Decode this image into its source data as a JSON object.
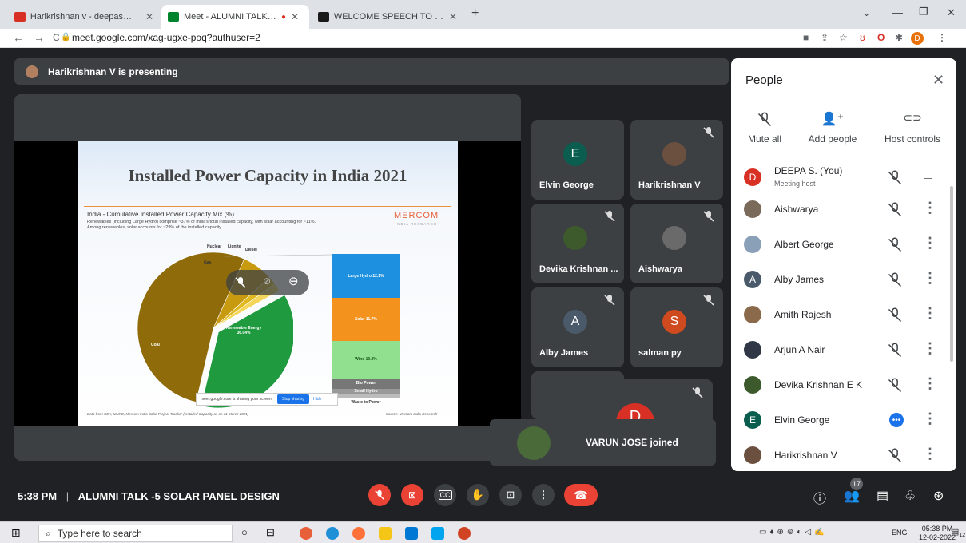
{
  "browser": {
    "tabs": [
      {
        "label": "Harikrishnan v - deepas@scmsgr",
        "favicon_color": "#d93025"
      },
      {
        "label": "Meet - ALUMNI TALK -5 SOL",
        "favicon_color": "#00832d"
      },
      {
        "label": "WELCOME SPEECH TO MEET ALU",
        "favicon_color": "#1a1a1a"
      }
    ],
    "new_tab": "+",
    "url": "meet.google.com/xag-ugxe-poq?authuser=2",
    "profile_initial": "D"
  },
  "meet": {
    "presenting_text": "Harikrishnan V is presenting",
    "slide": {
      "title": "Installed Power Capacity in India 2021",
      "chart_title": "India - Cumulative Installed Power Capacity Mix (%)",
      "chart_sub_1": "Renewables (including Large Hydro) comprise ~37% of India's total installed capacity, with solar accounting for ~11%.",
      "chart_sub_2": "Among renewables, solar accounts for ~29% of the installed capacity",
      "brand": "MERCOM",
      "brand_sub": "INDIA RESEARCH",
      "source_left": "Data from CEA, MNRE, Mercom India Solar Project Tracker (Installed Capacity as on 31 March 2021)",
      "source_right": "Source: Mercom India Research",
      "share_text": "meet.google.com is sharing your screen.",
      "stop_label": "Stop sharing",
      "hide_label": "Hide"
    },
    "tiles": [
      {
        "name": "Elvin George",
        "initial": "E",
        "color": "#0b5e4f"
      },
      {
        "name": "Harikrishnan V",
        "initial": "",
        "color": "#6b5040"
      },
      {
        "name": "Devika Krishnan ...",
        "initial": "",
        "color": "#3c5a2c"
      },
      {
        "name": "Aishwarya",
        "initial": "",
        "color": "#6a6a6a"
      },
      {
        "name": "Alby James",
        "initial": "A",
        "color": "#4a5a6a"
      },
      {
        "name": "salman py",
        "initial": "S",
        "color": "#d04a20"
      }
    ],
    "self_initial": "D",
    "toast": "VARUN JOSE joined",
    "clock": "5:38 PM",
    "divider": "|",
    "meeting_title": "ALUMNI TALK -5 SOLAR PANEL DESIGN",
    "participants_count": "17"
  },
  "chart_data": {
    "type": "pie",
    "title": "India - Cumulative Installed Power Capacity Mix (%)",
    "slices": [
      {
        "label": "Coal",
        "value": 52
      },
      {
        "label": "Renewable Energy",
        "value": 36.04
      },
      {
        "label": "Gas",
        "value": 6.5
      },
      {
        "label": "Nuclear",
        "value": 1.7
      },
      {
        "label": "Lignite",
        "value": 1.7
      },
      {
        "label": "Diesel",
        "value": 0.1
      }
    ],
    "breakdown": {
      "label": "Renewable Energy",
      "segments": [
        {
          "label": "Large Hydro 12.1%",
          "value": 12.1
        },
        {
          "label": "Solar 11.7%",
          "value": 11.7
        },
        {
          "label": "Wind 10.3%",
          "value": 10.3
        },
        {
          "label": "Bio Power",
          "value": 2.8
        },
        {
          "label": "Small Hydro",
          "value": 1.2
        },
        {
          "label": "Waste to Power",
          "value": 0.4
        }
      ]
    }
  },
  "people": {
    "title": "People",
    "actions": [
      "Mute all",
      "Add people",
      "Host controls"
    ],
    "list": [
      {
        "name": "DEEPA S. (You)",
        "sub": "Meeting host",
        "initial": "D",
        "color": "#d93025"
      },
      {
        "name": "Aishwarya",
        "initial": "",
        "color": "#7a6a5a"
      },
      {
        "name": "Albert George",
        "initial": "",
        "color": "#8aa0b8"
      },
      {
        "name": "Alby James",
        "initial": "A",
        "color": "#4a5a6a"
      },
      {
        "name": "Amith Rajesh",
        "initial": "",
        "color": "#8a6a4a"
      },
      {
        "name": "Arjun A Nair",
        "initial": "",
        "color": "#303848"
      },
      {
        "name": "Devika Krishnan E K",
        "initial": "",
        "color": "#3c5a2c"
      },
      {
        "name": "Elvin George",
        "initial": "E",
        "color": "#0b5e4f"
      },
      {
        "name": "Harikrishnan V",
        "initial": "",
        "color": "#6b5040"
      }
    ]
  },
  "taskbar": {
    "search_placeholder": "Type here to search",
    "lang": "ENG",
    "time": "05:38 PM",
    "date": "12-02-2022",
    "notif": "12"
  }
}
